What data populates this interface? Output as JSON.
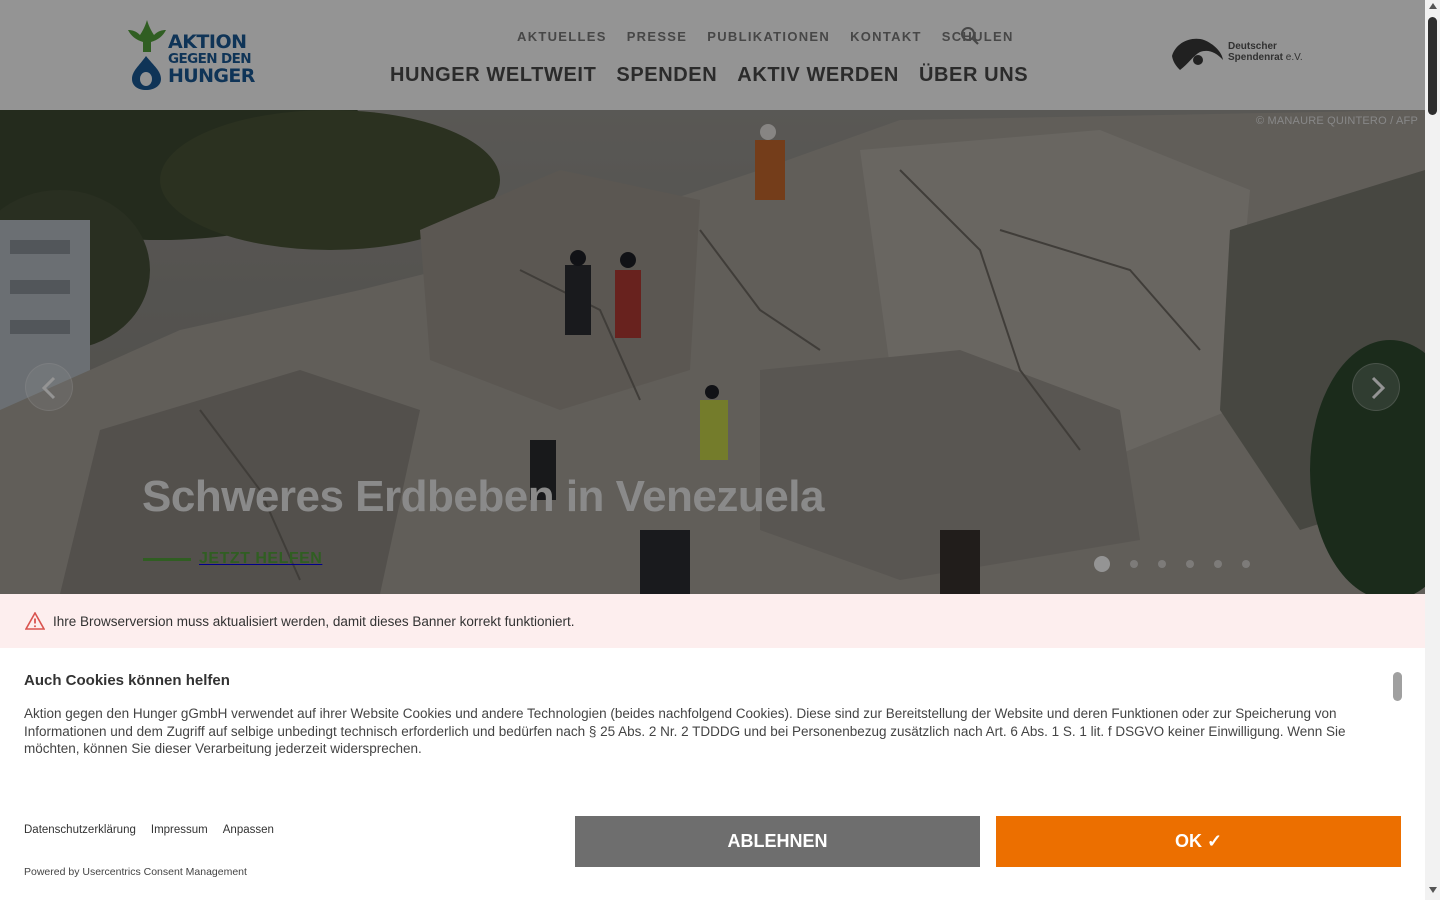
{
  "header": {
    "logo": {
      "line1": "AKTION",
      "line2": "GEGEN DEN",
      "line3": "HUNGER"
    },
    "top_nav": [
      "AKTUELLES",
      "PRESSE",
      "PUBLIKATIONEN",
      "KONTAKT",
      "SCHULEN"
    ],
    "main_nav": [
      "HUNGER WELTWEIT",
      "SPENDEN",
      "AKTIV WERDEN",
      "ÜBER UNS"
    ],
    "seal": {
      "line1": "Deutscher",
      "line2": "Spendenrat",
      "line2_suffix": "e.V."
    }
  },
  "hero": {
    "credit": "© MANAURE QUINTERO / AFP",
    "title": "Schweres Erdbeben in Venezuela",
    "cta": "JETZT HELFEN",
    "slides": 6,
    "active_slide": 1
  },
  "warning": {
    "text": "Ihre Browserversion muss aktualisiert werden, damit dieses Banner korrekt funktioniert."
  },
  "consent": {
    "title": "Auch Cookies können helfen",
    "body": "Aktion gegen den Hunger gGmbH verwendet auf ihrer Website Cookies und andere Technologien (beides nachfolgend Cookies). Diese sind zur Bereitstellung der Website und deren Funktionen oder zur Speicherung von Informationen und dem Zugriff auf selbige unbedingt technisch erforderlich und bedürfen nach § 25 Abs. 2 Nr. 2 TDDDG und bei Personenbezug zusätzlich nach Art. 6 Abs. 1 S. 1 lit. f DSGVO keiner Einwilligung. Wenn Sie möchten, können Sie dieser Verarbeitung jederzeit widersprechen.",
    "links": [
      "Datenschutzerklärung",
      "Impressum",
      "Anpassen"
    ],
    "powered_by": "Powered by Usercentrics Consent Management",
    "deny_label": "ABLEHNEN",
    "ok_label": "OK ✓"
  },
  "colors": {
    "brand_blue": "#1b5a96",
    "brand_green": "#53a33b",
    "accept_orange": "#ec6f00",
    "deny_grey": "#6e6e6e"
  }
}
